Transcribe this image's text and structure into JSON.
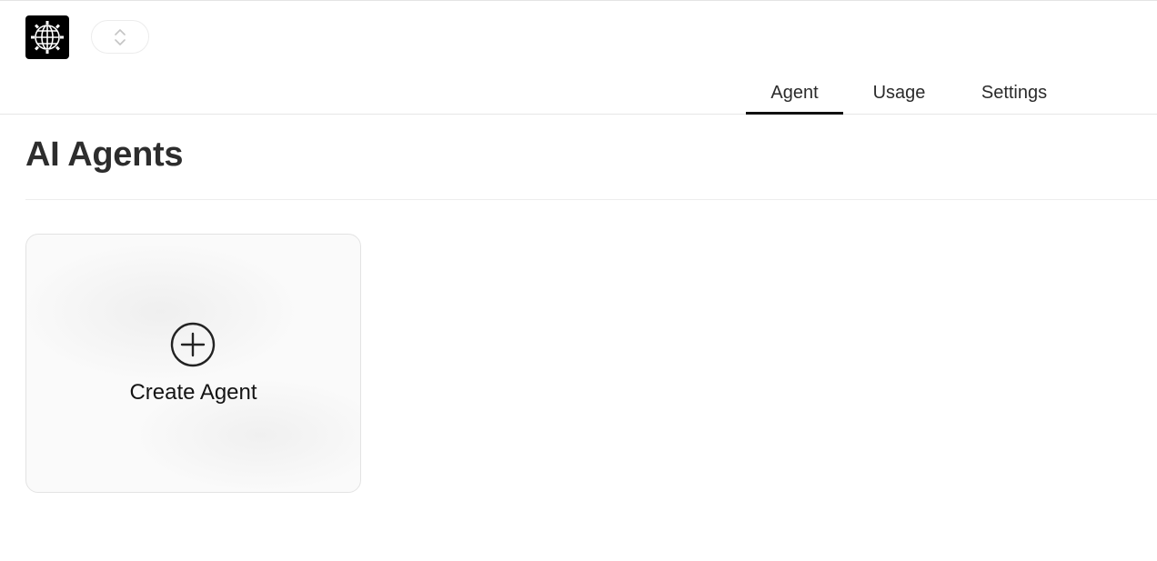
{
  "header": {
    "logo_icon": "globe-gear-icon",
    "switcher_icon": "chevron-up-down-icon",
    "tabs": [
      {
        "label": "Agent",
        "active": true
      },
      {
        "label": "Usage",
        "active": false
      },
      {
        "label": "Settings",
        "active": false
      }
    ]
  },
  "main": {
    "title": "AI Agents",
    "create_card": {
      "icon": "plus-circle-icon",
      "label": "Create Agent"
    }
  },
  "colors": {
    "accent": "#111111",
    "text": "#2d2d2d",
    "border": "#e3e3e3"
  }
}
